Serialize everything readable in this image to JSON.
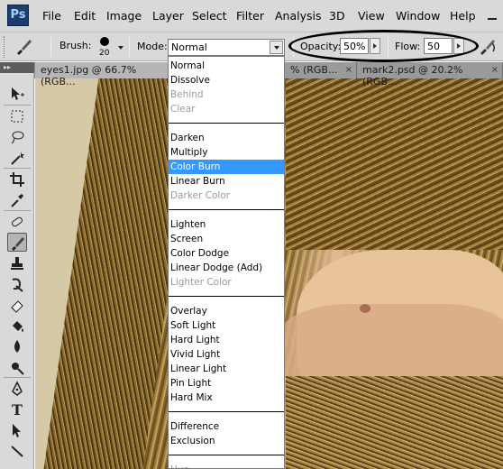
{
  "app": {
    "logo": "Ps"
  },
  "menubar": {
    "items": [
      "File",
      "Edit",
      "Image",
      "Layer",
      "Select",
      "Filter",
      "Analysis",
      "3D",
      "View",
      "Window",
      "Help"
    ]
  },
  "options": {
    "brush_label": "Brush:",
    "brush_size": "20",
    "mode_label": "Mode:",
    "mode_value": "Normal",
    "opacity_label": "Opacity:",
    "opacity_value": "50%",
    "flow_label": "Flow:",
    "flow_value": "50",
    "tool_icon": "brush-icon",
    "airbrush_icon": "airbrush-icon"
  },
  "tabs": [
    {
      "label": "eyes1.jpg @ 66.7% (RGB...",
      "close": "×"
    },
    {
      "label": "% (RGB...",
      "close": "×"
    },
    {
      "label": "mark2.psd @ 20.2% (RGB...",
      "close": "×"
    }
  ],
  "toolbox": {
    "tools": [
      "move-tool-icon",
      "marquee-tool-icon",
      "lasso-tool-icon",
      "magic-wand-icon",
      "crop-tool-icon",
      "eyedropper-icon",
      "healing-brush-icon",
      "brush-tool-icon",
      "clone-stamp-icon",
      "history-brush-icon",
      "eraser-icon",
      "paint-bucket-icon",
      "blur-tool-icon",
      "dodge-tool-icon",
      "pen-tool-icon",
      "type-tool-icon",
      "path-selection-icon",
      "line-tool-icon"
    ],
    "selected": "brush-tool-icon"
  },
  "blend_menu": {
    "items": [
      {
        "label": "Normal",
        "state": "normal"
      },
      {
        "label": "Dissolve",
        "state": "normal"
      },
      {
        "label": "Behind",
        "state": "disabled"
      },
      {
        "label": "Clear",
        "state": "disabled"
      },
      {
        "label": "Darken",
        "state": "normal"
      },
      {
        "label": "Multiply",
        "state": "normal"
      },
      {
        "label": "Color Burn",
        "state": "selected"
      },
      {
        "label": "Linear Burn",
        "state": "normal"
      },
      {
        "label": "Darker Color",
        "state": "disabled"
      },
      {
        "label": "Lighten",
        "state": "normal"
      },
      {
        "label": "Screen",
        "state": "normal"
      },
      {
        "label": "Color Dodge",
        "state": "normal"
      },
      {
        "label": "Linear Dodge (Add)",
        "state": "normal"
      },
      {
        "label": "Lighter Color",
        "state": "disabled"
      },
      {
        "label": "Overlay",
        "state": "normal"
      },
      {
        "label": "Soft Light",
        "state": "normal"
      },
      {
        "label": "Hard Light",
        "state": "normal"
      },
      {
        "label": "Vivid Light",
        "state": "normal"
      },
      {
        "label": "Linear Light",
        "state": "normal"
      },
      {
        "label": "Pin Light",
        "state": "normal"
      },
      {
        "label": "Hard Mix",
        "state": "normal"
      },
      {
        "label": "Difference",
        "state": "normal"
      },
      {
        "label": "Exclusion",
        "state": "normal"
      },
      {
        "label": "Hue",
        "state": "disabled"
      }
    ]
  },
  "colors": {
    "selection": "#3399ff",
    "chrome": "#d9d9d9"
  }
}
